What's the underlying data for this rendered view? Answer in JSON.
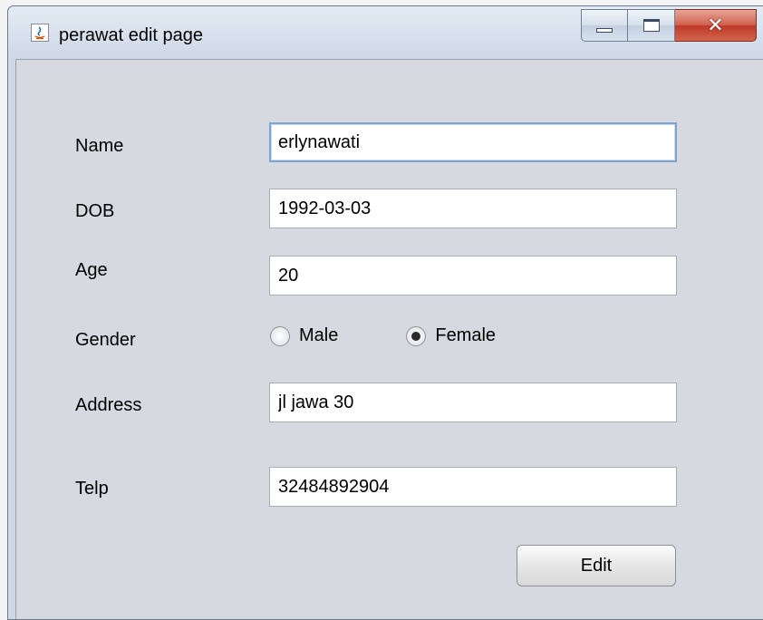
{
  "window": {
    "title": "perawat edit page"
  },
  "form": {
    "name": {
      "label": "Name",
      "value": "erlynawati"
    },
    "dob": {
      "label": "DOB",
      "value": "1992-03-03"
    },
    "age": {
      "label": "Age",
      "value": "20"
    },
    "gender": {
      "label": "Gender",
      "options": [
        "Male",
        "Female"
      ],
      "selected": "Female"
    },
    "address": {
      "label": "Address",
      "value": "jl jawa 30"
    },
    "telp": {
      "label": "Telp",
      "value": "32484892904"
    },
    "edit_label": "Edit"
  }
}
